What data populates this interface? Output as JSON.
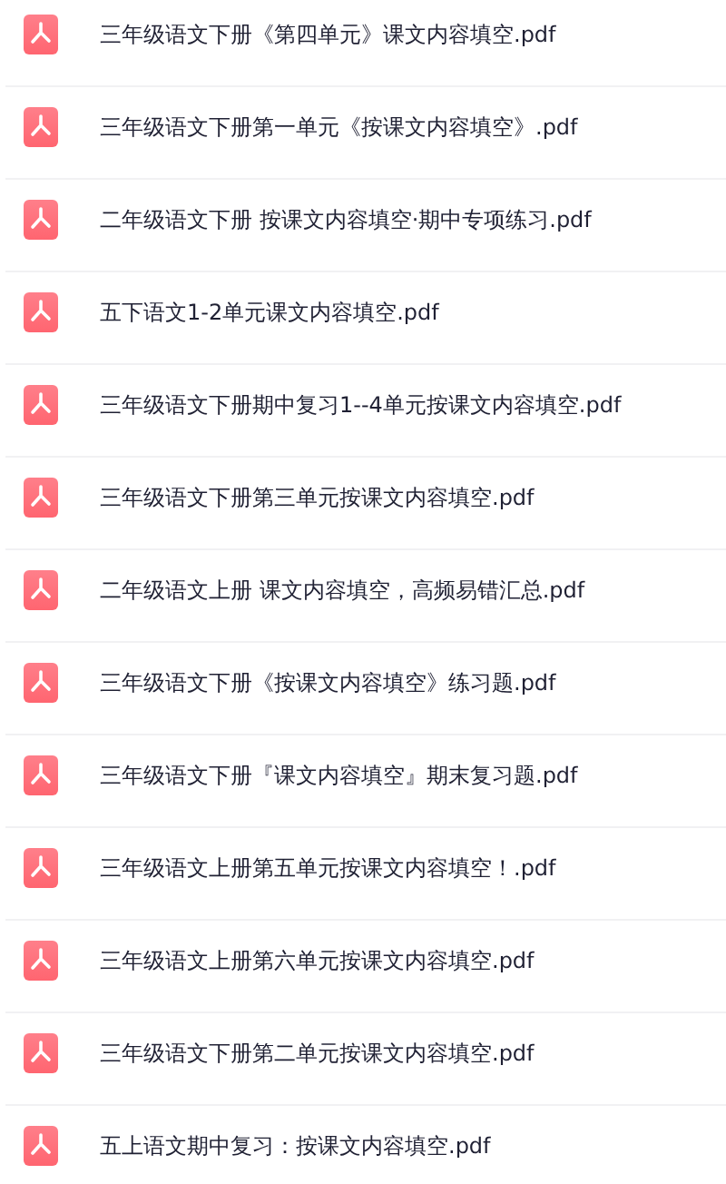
{
  "files": [
    {
      "name": "三年级语文下册《第四单元》课文内容填空.pdf"
    },
    {
      "name": "三年级语文下册第一单元《按课文内容填空》.pdf"
    },
    {
      "name": "二年级语文下册 按课文内容填空·期中专项练习.pdf"
    },
    {
      "name": "五下语文1-2单元课文内容填空.pdf"
    },
    {
      "name": "三年级语文下册期中复习1--4单元按课文内容填空.pdf"
    },
    {
      "name": "三年级语文下册第三单元按课文内容填空.pdf"
    },
    {
      "name": "二年级语文上册 课文内容填空，高频易错汇总.pdf"
    },
    {
      "name": "三年级语文下册《按课文内容填空》练习题.pdf"
    },
    {
      "name": "三年级语文下册『课文内容填空』期末复习题.pdf"
    },
    {
      "name": "三年级语文上册第五单元按课文内容填空！.pdf"
    },
    {
      "name": "三年级语文上册第六单元按课文内容填空.pdf"
    },
    {
      "name": "三年级语文下册第二单元按课文内容填空.pdf"
    },
    {
      "name": "五上语文期中复习：按课文内容填空.pdf"
    }
  ]
}
